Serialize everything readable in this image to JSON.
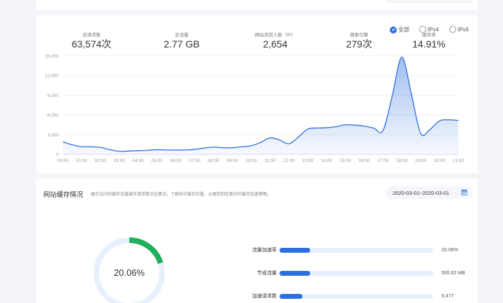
{
  "filters": [
    {
      "label": "全部",
      "checked": true
    },
    {
      "label": "IPv4",
      "checked": false
    },
    {
      "label": "IPv6",
      "checked": false
    }
  ],
  "stats": [
    {
      "label": "总请求数",
      "value": "63,574次"
    },
    {
      "label": "总流量",
      "value": "2.77 GB"
    },
    {
      "label": "网站浏览人数（IP）",
      "value": "2,654"
    },
    {
      "label": "搜索引擎",
      "value": "279次"
    },
    {
      "label": "缓存率",
      "value": "14.91%"
    }
  ],
  "chart_data": {
    "type": "area",
    "x": [
      "00:00",
      "00:30",
      "01:00",
      "01:30",
      "02:00",
      "02:30",
      "03:00",
      "03:30",
      "04:00",
      "04:30",
      "05:00",
      "05:30",
      "06:00",
      "06:30",
      "07:00",
      "07:30",
      "08:00",
      "08:30",
      "09:00",
      "09:30",
      "10:00",
      "10:30",
      "11:00",
      "11:30",
      "12:00",
      "12:30",
      "13:00",
      "13:30",
      "14:00",
      "14:30",
      "15:00",
      "15:30",
      "16:00",
      "16:30",
      "17:00",
      "17:30",
      "18:00",
      "18:30",
      "19:00",
      "19:30",
      "20:00",
      "20:30",
      "21:00"
    ],
    "tick_labels": [
      "00:00",
      "01:00",
      "02:00",
      "03:00",
      "04:00",
      "05:00",
      "06:00",
      "07:00",
      "08:00",
      "09:00",
      "10:00",
      "11:00",
      "12:00",
      "13:00",
      "14:00",
      "15:00",
      "16:00",
      "17:00",
      "18:00",
      "19:00",
      "20:00",
      "21:00"
    ],
    "series": [
      {
        "values": [
          1900,
          1450,
          1150,
          1150,
          1050,
          700,
          450,
          500,
          550,
          600,
          700,
          650,
          650,
          650,
          750,
          950,
          1100,
          1000,
          1000,
          1150,
          1300,
          1800,
          2500,
          2200,
          1600,
          2600,
          3850,
          4000,
          4050,
          4200,
          4500,
          4450,
          4300,
          4000,
          3600,
          9000,
          14800,
          9300,
          3200,
          3800,
          5100,
          5250,
          5150
        ]
      }
    ],
    "ylim": [
      0,
      15000
    ],
    "yticks": [
      "0",
      "3,000",
      "6,000",
      "9,000",
      "12,000",
      "15,000"
    ],
    "line_color": "#2d6fe0",
    "grid": true
  },
  "cache": {
    "title": "网站缓存情况",
    "description": "展示访问的缓存流量缓存请求数对比情况，了解命中缓存的量，以便您制定更好的缓存加速策略。",
    "date_range": "2020-03-01~2020-03-01",
    "donut_value": "20.06%",
    "donut_percent": 20.06,
    "donut_color": "#1fb05c",
    "donut_track": "#e8f0fd",
    "rows": [
      {
        "label": "流量加速率",
        "value": "20.06%",
        "fill": 0.2
      },
      {
        "label": "节省流量",
        "value": "555.62 MB",
        "fill": 0.2
      },
      {
        "label": "加速请求数",
        "value": "9,477",
        "fill": 0.15
      }
    ]
  },
  "icons": {
    "calendar": "calendar-icon",
    "check": "check-icon"
  }
}
